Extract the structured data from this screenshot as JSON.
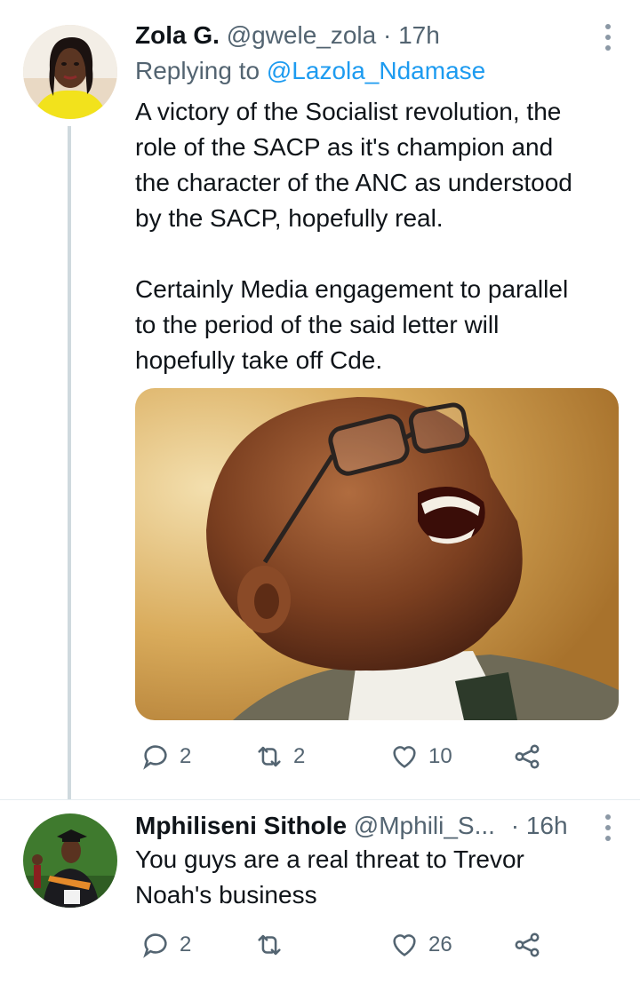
{
  "tweets": [
    {
      "name": "Zola G.",
      "handle": "@gwele_zola",
      "separator": "·",
      "time": "17h",
      "replying_label": "Replying to",
      "replying_handle": "@Lazola_Ndamase",
      "text": "A victory of the Socialist revolution, the\nrole of the SACP as it's champion and\nthe character of the ANC as understood\nby the SACP, hopefully real.\n\nCertainly Media engagement to parallel\nto the period of the said letter will\nhopefully take off Cde.",
      "media_icon": "photo-laughing-man-glasses",
      "counts": {
        "replies": "2",
        "retweets": "2",
        "likes": "10"
      }
    },
    {
      "name": "Mphiliseni Sithole",
      "handle": "@Mphili_S...",
      "separator": "·",
      "time": "16h",
      "text": "You guys are a real threat to Trevor\nNoah's business",
      "counts": {
        "replies": "2",
        "retweets": "",
        "likes": "26"
      }
    }
  ],
  "icons": {
    "reply": "reply-icon",
    "retweet": "retweet-icon",
    "like": "heart-icon",
    "share": "share-icon",
    "more": "more-vertical-icon"
  },
  "colors": {
    "link": "#1d9bf0",
    "muted": "#536471",
    "text": "#0f1419",
    "thread_line": "#cfd9de"
  }
}
